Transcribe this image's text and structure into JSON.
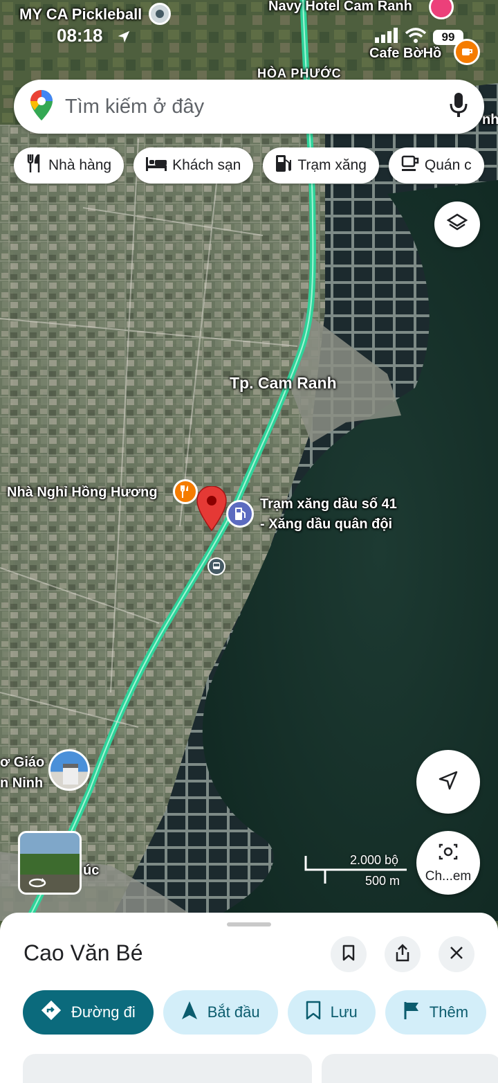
{
  "status": {
    "app_back": "MY CA Pickleball",
    "time": "08:18",
    "battery": "99"
  },
  "search": {
    "placeholder": "Tìm kiếm ở đây"
  },
  "chips": [
    {
      "label": "Nhà hàng",
      "icon": "fork-knife-icon"
    },
    {
      "label": "Khách sạn",
      "icon": "bed-icon"
    },
    {
      "label": "Trạm xăng",
      "icon": "gas-pump-icon"
    },
    {
      "label": "Quán c",
      "icon": "coffee-icon"
    }
  ],
  "map": {
    "labels": {
      "navy_hotel": "Navy Hotel Cam Ranh",
      "cafe": "Cafe BờHồ",
      "hoa_phuoc": "HÒA PHƯỚC",
      "city": "Tp. Cam Ranh",
      "nha_nghi": "Nhà Nghỉ Hồng Hương",
      "station_line1": "Trạm xăng dầu số 41",
      "station_line2": "- Xăng dầu quân đội",
      "church_line1": "ơ Giáo",
      "church_line2": "n Ninh",
      "edge_left_word": "úc",
      "edge_right_word": "nh"
    },
    "colors": {
      "road": "#2ed39a",
      "pin": "#e53935",
      "food": "#f57c00",
      "gas": "#5c6bc0"
    }
  },
  "scale": {
    "feet": "2.000 bộ",
    "meters": "500 m"
  },
  "camera_button": {
    "label": "Ch...em"
  },
  "place": {
    "name": "Cao Văn Bé",
    "actions": [
      {
        "label": "Đường đi",
        "icon": "directions-icon"
      },
      {
        "label": "Bắt đầu",
        "icon": "navigation-arrow-icon"
      },
      {
        "label": "Lưu",
        "icon": "bookmark-icon"
      },
      {
        "label": "Thêm",
        "icon": "flag-icon"
      }
    ]
  }
}
